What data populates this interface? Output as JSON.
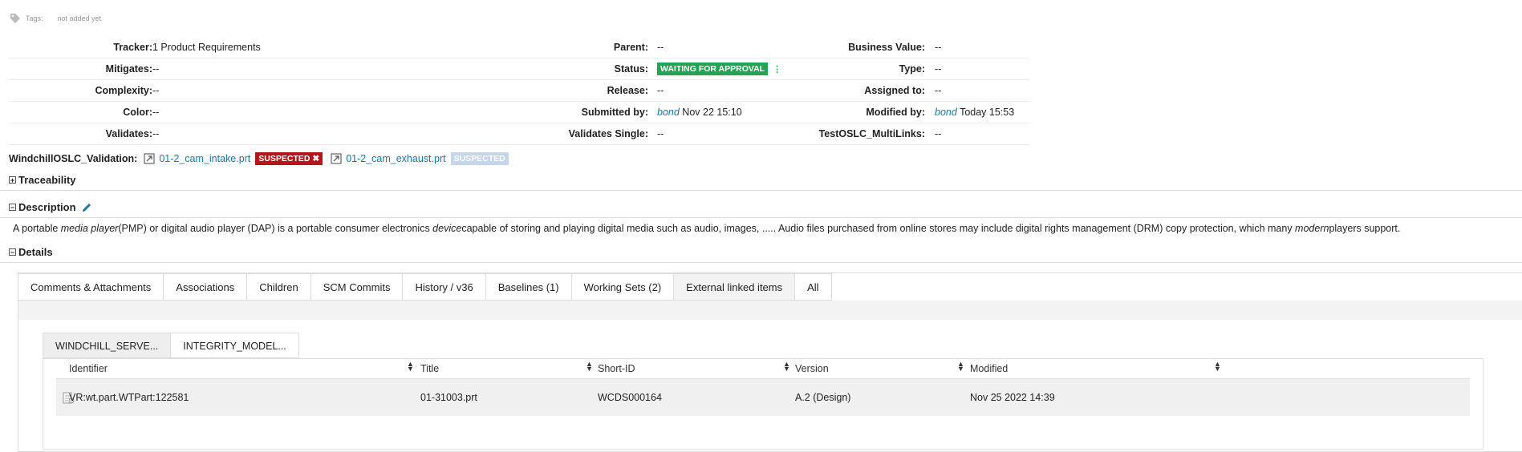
{
  "tags": {
    "label": "Tags:",
    "value": "not added yet"
  },
  "properties": {
    "tracker": {
      "label": "Tracker:",
      "value": "1 Product Requirements"
    },
    "parent": {
      "label": "Parent:",
      "value": "--"
    },
    "business_value": {
      "label": "Business Value:",
      "value": "--"
    },
    "mitigates": {
      "label": "Mitigates:",
      "value": "--"
    },
    "status": {
      "label": "Status:",
      "value": "WAITING FOR APPROVAL"
    },
    "type": {
      "label": "Type:",
      "value": "--"
    },
    "complexity": {
      "label": "Complexity:",
      "value": "--"
    },
    "release": {
      "label": "Release:",
      "value": "--"
    },
    "assigned_to": {
      "label": "Assigned to:",
      "value": "--"
    },
    "color": {
      "label": "Color:",
      "value": "--"
    },
    "submitted_by": {
      "label": "Submitted by:",
      "user": "bond",
      "date": "Nov 22 15:10"
    },
    "modified_by": {
      "label": "Modified by:",
      "user": "bond",
      "date": "Today 15:53"
    },
    "validates": {
      "label": "Validates:",
      "value": "--"
    },
    "validates_single": {
      "label": "Validates Single:",
      "value": "--"
    },
    "test_oslc": {
      "label": "TestOSLC_MultiLinks:",
      "value": "--"
    }
  },
  "windchill": {
    "label": "WindchillOSLC_Validation:",
    "link1": "01-2_cam_intake.prt",
    "badge1": "SUSPECTED ✖",
    "link2": "01-2_cam_exhaust.prt",
    "badge2": "SUSPECTED"
  },
  "sections": {
    "traceability": "Traceability",
    "description": "Description",
    "details": "Details"
  },
  "description": {
    "p1": "A portable ",
    "em1": "media player",
    "p2": "(PMP) or digital audio player (DAP) is a portable consumer electronics ",
    "em2": "device",
    "p3": "capable of storing and playing digital media such as audio, images, ..... Audio files purchased from online stores may include digital rights management (DRM) copy protection, which many ",
    "em3": "modern",
    "p4": "players support."
  },
  "tabs": [
    "Comments & Attachments",
    "Associations",
    "Children",
    "SCM Commits",
    "History / v36",
    "Baselines (1)",
    "Working Sets (2)",
    "External linked items",
    "All"
  ],
  "subtabs": [
    "WINDCHILL_SERVE...",
    "INTEGRITY_MODEL..."
  ],
  "table": {
    "headers": [
      "Identifier",
      "Title",
      "Short-ID",
      "Version",
      "Modified"
    ],
    "rows": [
      {
        "identifier": "VR:wt.part.WTPart:122581",
        "title": "01-31003.prt",
        "short_id": "WCDS000164",
        "version": "A.2 (Design)",
        "modified": "Nov 25 2022 14:39"
      }
    ]
  }
}
